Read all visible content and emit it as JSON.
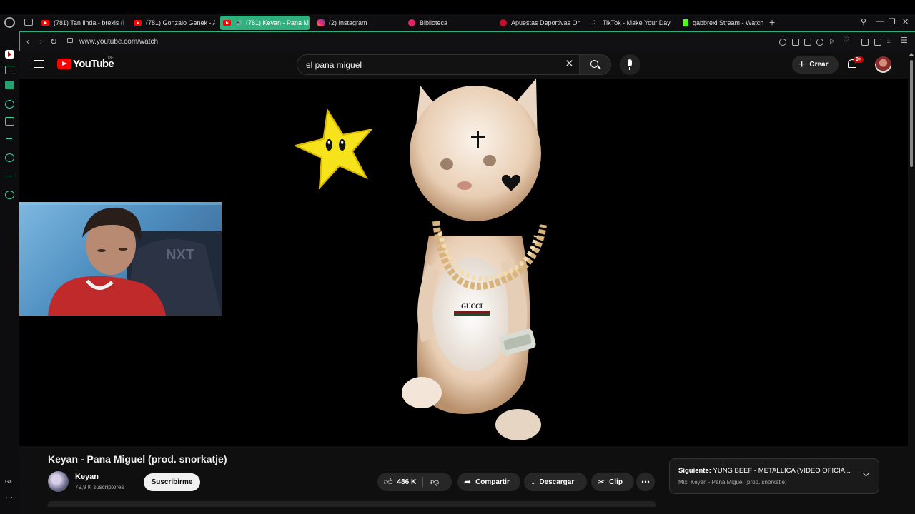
{
  "browser": {
    "tabs": [
      {
        "label": "(781) Tan linda - brexis (P",
        "icon": "youtube"
      },
      {
        "label": "(781) Gonzalo Genek - Ac",
        "icon": "youtube"
      },
      {
        "label": "(781) Keyan - Pana M",
        "icon": "youtube",
        "active": true
      },
      {
        "label": "(2) Instagram",
        "icon": "instagram"
      },
      {
        "label": "Biblioteca",
        "icon": "library"
      },
      {
        "label": "Apuestas Deportivas Onli",
        "icon": "betting"
      },
      {
        "label": "TikTok - Make Your Day",
        "icon": "tiktok"
      },
      {
        "label": "gabbrexl Stream - Watch",
        "icon": "kick"
      }
    ],
    "url": "www.youtube.com/watch",
    "sidebar_label": "GX",
    "accent": "#2fb07d"
  },
  "youtube": {
    "logo_text": "YouTube",
    "country": "PE",
    "search_value": "el pana miguel",
    "create_label": "Crear",
    "notification_count": "9+"
  },
  "video": {
    "title": "Keyan - Pana Miguel (prod. snorkatje)",
    "channel": "Keyan",
    "subscribers": "79,9 K suscriptores",
    "subscribe_label": "Suscribirme",
    "likes": "486 K",
    "share_label": "Compartir",
    "download_label": "Descargar",
    "clip_label": "Clip",
    "chain_text": "GUCCI"
  },
  "up_next": {
    "prefix": "Siguiente:",
    "title": "YUNG BEEF - METALLICA (VIDEO OFICIA...",
    "mix": "Mix: Keyan - Pana Miguel (prod. snorkatje)"
  }
}
